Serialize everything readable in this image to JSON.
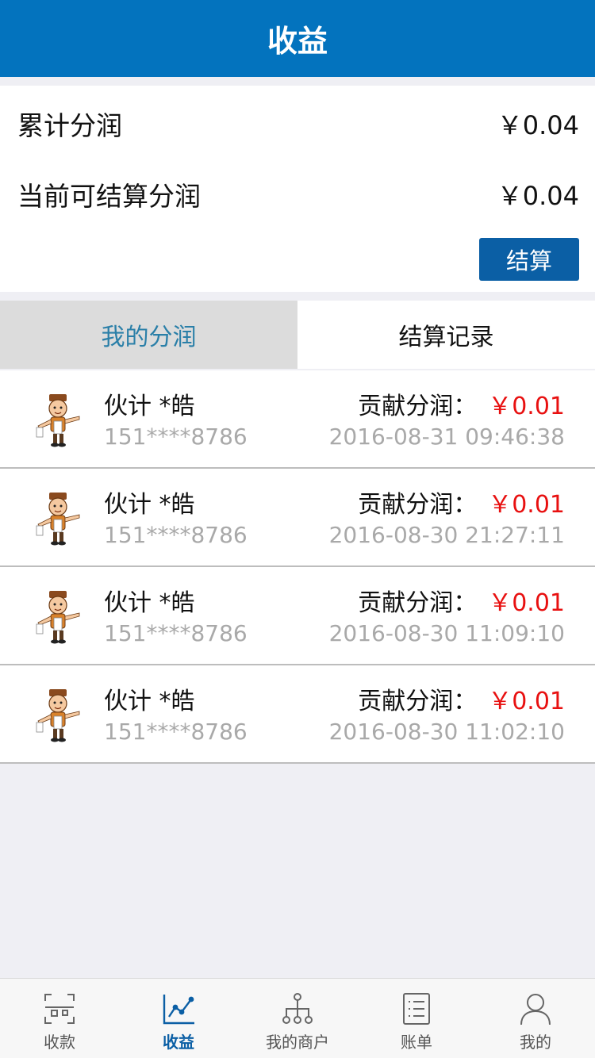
{
  "header": {
    "title": "收益"
  },
  "summary": {
    "total_label": "累计分润",
    "total_value": "￥0.04",
    "settleable_label": "当前可结算分润",
    "settleable_value": "￥0.04",
    "settle_button": "结算"
  },
  "tabs": [
    {
      "label": "我的分润",
      "active": true
    },
    {
      "label": "结算记录",
      "active": false
    }
  ],
  "records": [
    {
      "name": "伙计 *皓",
      "phone": "151****8786",
      "contrib_label": "贡献分润：",
      "amount": "￥0.01",
      "time": "2016-08-31 09:46:38"
    },
    {
      "name": "伙计 *皓",
      "phone": "151****8786",
      "contrib_label": "贡献分润：",
      "amount": "￥0.01",
      "time": "2016-08-30 21:27:11"
    },
    {
      "name": "伙计 *皓",
      "phone": "151****8786",
      "contrib_label": "贡献分润：",
      "amount": "￥0.01",
      "time": "2016-08-30 11:09:10"
    },
    {
      "name": "伙计 *皓",
      "phone": "151****8786",
      "contrib_label": "贡献分润：",
      "amount": "￥0.01",
      "time": "2016-08-30 11:02:10"
    }
  ],
  "tabbar": [
    {
      "label": "收款",
      "icon": "scan-icon"
    },
    {
      "label": "收益",
      "icon": "line-chart-icon",
      "active": true
    },
    {
      "label": "我的商户",
      "icon": "org-tree-icon"
    },
    {
      "label": "账单",
      "icon": "bill-list-icon"
    },
    {
      "label": "我的",
      "icon": "user-icon"
    }
  ],
  "colors": {
    "header_bg": "#0373be",
    "button_bg": "#0b5fa5",
    "amount_red": "#e81010",
    "active_tab_text": "#2a7fa8"
  }
}
